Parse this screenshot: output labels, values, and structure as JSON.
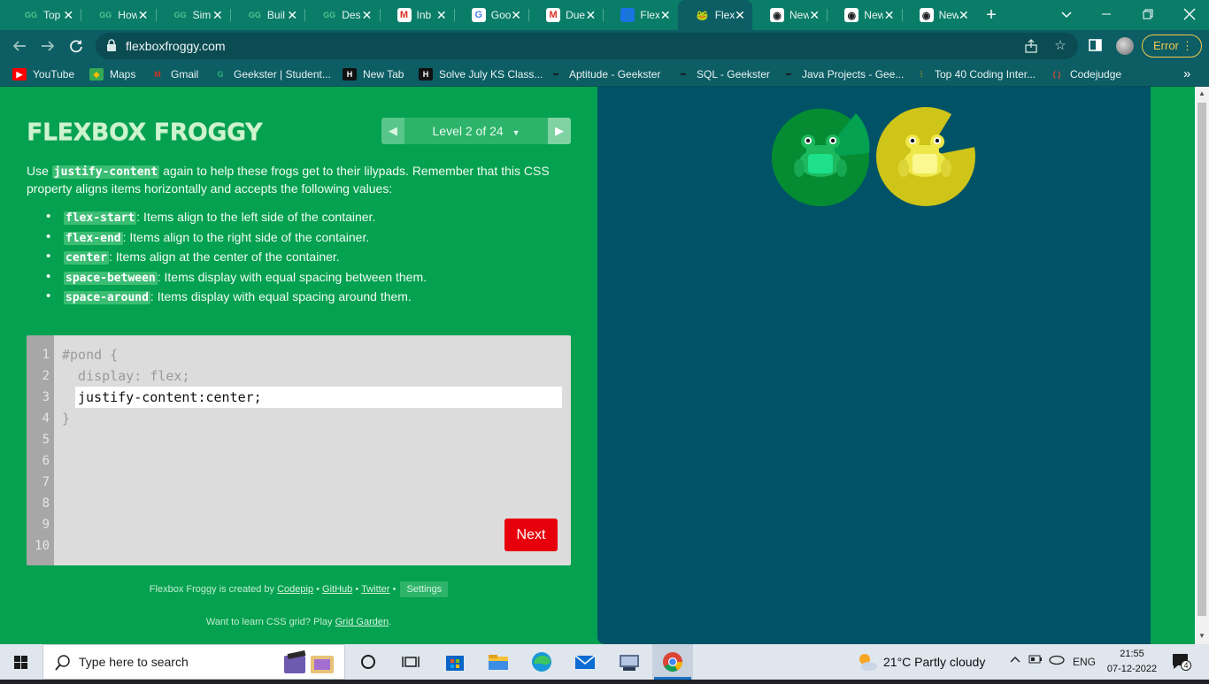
{
  "browser": {
    "tabs": [
      {
        "label": "Top",
        "favicon": "geeksforgeeks-icon"
      },
      {
        "label": "How",
        "favicon": "geeksforgeeks-icon"
      },
      {
        "label": "Sim",
        "favicon": "geeksforgeeks-icon"
      },
      {
        "label": "Buil",
        "favicon": "geeksforgeeks-icon"
      },
      {
        "label": "Des",
        "favicon": "geeksforgeeks-icon"
      },
      {
        "label": "Inb",
        "favicon": "gmail-icon"
      },
      {
        "label": "Goo",
        "favicon": "google-icon"
      },
      {
        "label": "Due",
        "favicon": "gmail-icon"
      },
      {
        "label": "Flex",
        "favicon": "contacts-icon"
      },
      {
        "label": "Flex",
        "favicon": "frog-icon",
        "active": true
      },
      {
        "label": "New",
        "favicon": "chrome-icon"
      },
      {
        "label": "New",
        "favicon": "chrome-icon"
      },
      {
        "label": "New",
        "favicon": "chrome-icon"
      }
    ],
    "url": "flexboxfroggy.com",
    "error_label": "Error",
    "bookmarks": [
      {
        "label": "YouTube",
        "icon": "youtube-icon"
      },
      {
        "label": "Maps",
        "icon": "maps-icon"
      },
      {
        "label": "Gmail",
        "icon": "gmail-icon"
      },
      {
        "label": "Geekster | Student...",
        "icon": "geekster-icon"
      },
      {
        "label": "New Tab",
        "icon": "hackerrank-icon"
      },
      {
        "label": "Solve July KS Class...",
        "icon": "hackerrank-icon"
      },
      {
        "label": "Aptitude - Geekster",
        "icon": "geekster-t-icon"
      },
      {
        "label": "SQL - Geekster",
        "icon": "geekster-t-icon"
      },
      {
        "label": "Java Projects - Gee...",
        "icon": "geekster-t-icon"
      },
      {
        "label": "Top 40 Coding Inter...",
        "icon": "bookmark-icon"
      },
      {
        "label": "Codejudge",
        "icon": "codejudge-icon"
      }
    ],
    "more_bookmarks": "»"
  },
  "game": {
    "logo": "FLEXBOX FROGGY",
    "level_label": "Level 2 of 24",
    "instructions": {
      "pre": "Use ",
      "keyword": "justify-content",
      "post": " again to help these frogs get to their lilypads. Remember that this CSS property aligns items horizontally and accepts the following values:"
    },
    "values": [
      {
        "code": "flex-start",
        "desc": ": Items align to the left side of the container."
      },
      {
        "code": "flex-end",
        "desc": ": Items align to the right side of the container."
      },
      {
        "code": "center",
        "desc": ": Items align at the center of the container."
      },
      {
        "code": "space-between",
        "desc": ": Items display with equal spacing between them."
      },
      {
        "code": "space-around",
        "desc": ": Items display with equal spacing around them."
      }
    ],
    "editor": {
      "line_numbers": [
        "1",
        "2",
        "3",
        "4",
        "5",
        "6",
        "7",
        "8",
        "9",
        "10"
      ],
      "line1": "#pond {",
      "line2": "  display: flex;",
      "input_value": "justify-content:center;",
      "line4": "}"
    },
    "next_label": "Next",
    "footer": {
      "created_pre": "Flexbox Froggy is created by ",
      "codepip": "Codepip",
      "bullet": " • ",
      "github": "GitHub",
      "twitter": "Twitter",
      "settings": "Settings",
      "grid_pre": "Want to learn CSS grid? Play ",
      "grid_link": "Grid Garden",
      "grid_post": "."
    },
    "colors": {
      "green_frog": "#1fd07a",
      "yellow_frog": "#f9f36c",
      "pond": "#005367",
      "page": "#03a150"
    }
  },
  "taskbar": {
    "search_placeholder": "Type here to search",
    "weather": "21°C  Partly cloudy",
    "lang": "ENG",
    "time": "21:55",
    "date": "07-12-2022",
    "notification_count": "4"
  }
}
